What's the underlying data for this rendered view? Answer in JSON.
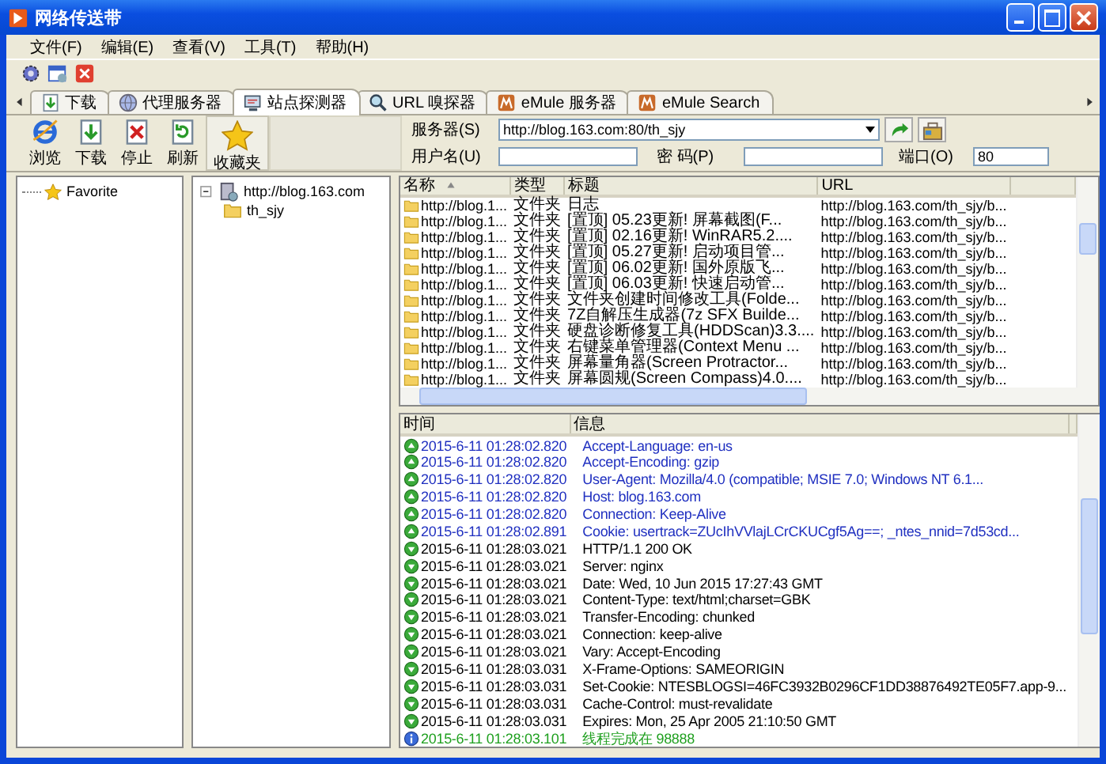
{
  "window": {
    "title": "网络传送带"
  },
  "menu": [
    "文件(F)",
    "编辑(E)",
    "查看(V)",
    "工具(T)",
    "帮助(H)"
  ],
  "tabs": [
    {
      "label": "下载",
      "kind": "download",
      "selected": false
    },
    {
      "label": "代理服务器",
      "kind": "proxy",
      "selected": false
    },
    {
      "label": "站点探测器",
      "kind": "probe",
      "selected": true
    },
    {
      "label": "URL 嗅探器",
      "kind": "sniffer",
      "selected": false
    },
    {
      "label": "eMule 服务器",
      "kind": "emule",
      "selected": false
    },
    {
      "label": "eMule Search",
      "kind": "emule",
      "selected": false
    }
  ],
  "actions": [
    {
      "label": "浏览",
      "kind": "browse"
    },
    {
      "label": "下载",
      "kind": "download"
    },
    {
      "label": "停止",
      "kind": "stop"
    },
    {
      "label": "刷新",
      "kind": "refresh"
    },
    {
      "label": "收藏夹",
      "kind": "favorites"
    }
  ],
  "connection": {
    "server_label": "服务器(S)",
    "server": "http://blog.163.com:80/th_sjy",
    "user_label": "用户名(U)",
    "password_label": "密  码(P)",
    "port_label": "端口(O)",
    "port": "80"
  },
  "favorites": [
    {
      "label": "Favorite"
    }
  ],
  "site_tree": [
    {
      "label": "http://blog.163.com",
      "expanded": true,
      "children": [
        {
          "label": "th_sjy"
        }
      ]
    }
  ],
  "table": {
    "columns": [
      {
        "label": "名称",
        "sorted": true
      },
      {
        "label": "类型",
        "sorted": false
      },
      {
        "label": "标题",
        "sorted": false
      },
      {
        "label": "URL",
        "sorted": false
      }
    ],
    "rows": [
      {
        "name": "http://blog.1...",
        "type": "文件夹",
        "title": "日志",
        "url": "http://blog.163.com/th_sjy/b..."
      },
      {
        "name": "http://blog.1...",
        "type": "文件夹",
        "title": "[置顶] 05.23更新! 屏幕截图(F...",
        "url": "http://blog.163.com/th_sjy/b..."
      },
      {
        "name": "http://blog.1...",
        "type": "文件夹",
        "title": "[置顶] 02.16更新! WinRAR5.2....",
        "url": "http://blog.163.com/th_sjy/b..."
      },
      {
        "name": "http://blog.1...",
        "type": "文件夹",
        "title": "[置顶] 05.27更新! 启动项目管...",
        "url": "http://blog.163.com/th_sjy/b..."
      },
      {
        "name": "http://blog.1...",
        "type": "文件夹",
        "title": "[置顶] 06.02更新! 国外原版飞...",
        "url": "http://blog.163.com/th_sjy/b..."
      },
      {
        "name": "http://blog.1...",
        "type": "文件夹",
        "title": "[置顶] 06.03更新! 快速启动管...",
        "url": "http://blog.163.com/th_sjy/b..."
      },
      {
        "name": "http://blog.1...",
        "type": "文件夹",
        "title": "文件夹创建时间修改工具(Folde...",
        "url": "http://blog.163.com/th_sjy/b..."
      },
      {
        "name": "http://blog.1...",
        "type": "文件夹",
        "title": "7Z自解压生成器(7z SFX Builde...",
        "url": "http://blog.163.com/th_sjy/b..."
      },
      {
        "name": "http://blog.1...",
        "type": "文件夹",
        "title": "硬盘诊断修复工具(HDDScan)3.3....",
        "url": "http://blog.163.com/th_sjy/b..."
      },
      {
        "name": "http://blog.1...",
        "type": "文件夹",
        "title": "右键菜单管理器(Context Menu ...",
        "url": "http://blog.163.com/th_sjy/b..."
      },
      {
        "name": "http://blog.1...",
        "type": "文件夹",
        "title": "屏幕量角器(Screen Protractor...",
        "url": "http://blog.163.com/th_sjy/b..."
      },
      {
        "name": "http://blog.1...",
        "type": "文件夹",
        "title": "屏幕圆规(Screen Compass)4.0....",
        "url": "http://blog.163.com/th_sjy/b..."
      }
    ]
  },
  "log": {
    "columns": [
      "时间",
      "信息"
    ],
    "entries": [
      {
        "kind": "sent",
        "time": "2015-6-11 01:28:02.820",
        "message": "Accept-Language: en-us"
      },
      {
        "kind": "sent",
        "time": "2015-6-11 01:28:02.820",
        "message": "Accept-Encoding: gzip"
      },
      {
        "kind": "sent",
        "time": "2015-6-11 01:28:02.820",
        "message": "User-Agent: Mozilla/4.0 (compatible; MSIE 7.0; Windows NT 6.1..."
      },
      {
        "kind": "sent",
        "time": "2015-6-11 01:28:02.820",
        "message": "Host: blog.163.com"
      },
      {
        "kind": "sent",
        "time": "2015-6-11 01:28:02.820",
        "message": "Connection: Keep-Alive"
      },
      {
        "kind": "sent",
        "time": "2015-6-11 01:28:02.891",
        "message": "Cookie: usertrack=ZUcIhVVlajLCrCKUCgf5Ag==; _ntes_nnid=7d53cd..."
      },
      {
        "kind": "received",
        "time": "2015-6-11 01:28:03.021",
        "message": "HTTP/1.1 200 OK"
      },
      {
        "kind": "received",
        "time": "2015-6-11 01:28:03.021",
        "message": "Server: nginx"
      },
      {
        "kind": "received",
        "time": "2015-6-11 01:28:03.021",
        "message": "Date: Wed, 10 Jun 2015 17:27:43 GMT"
      },
      {
        "kind": "received",
        "time": "2015-6-11 01:28:03.021",
        "message": "Content-Type: text/html;charset=GBK"
      },
      {
        "kind": "received",
        "time": "2015-6-11 01:28:03.021",
        "message": "Transfer-Encoding: chunked"
      },
      {
        "kind": "received",
        "time": "2015-6-11 01:28:03.021",
        "message": "Connection: keep-alive"
      },
      {
        "kind": "received",
        "time": "2015-6-11 01:28:03.021",
        "message": "Vary: Accept-Encoding"
      },
      {
        "kind": "received",
        "time": "2015-6-11 01:28:03.031",
        "message": "X-Frame-Options: SAMEORIGIN"
      },
      {
        "kind": "received",
        "time": "2015-6-11 01:28:03.031",
        "message": "Set-Cookie: NTESBLOGSI=46FC3932B0296CF1DD38876492TE05F7.app-9..."
      },
      {
        "kind": "received",
        "time": "2015-6-11 01:28:03.031",
        "message": "Cache-Control: must-revalidate"
      },
      {
        "kind": "received",
        "time": "2015-6-11 01:28:03.031",
        "message": "Expires: Mon, 25 Apr 2005 21:10:50 GMT"
      },
      {
        "kind": "info",
        "time": "2015-6-11 01:28:03.101",
        "message": "线程完成在 98888"
      }
    ]
  }
}
